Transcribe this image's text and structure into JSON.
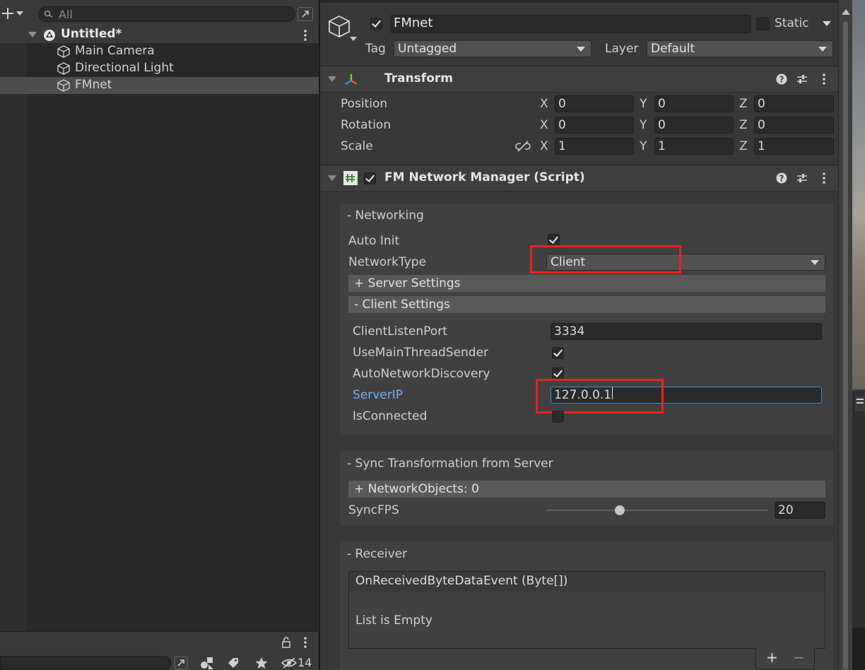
{
  "hierarchy": {
    "search_placeholder": "All",
    "scene_name": "Untitled*",
    "items": [
      {
        "label": "Main Camera"
      },
      {
        "label": "Directional Light"
      },
      {
        "label": "FMnet"
      }
    ],
    "hidden_count": "14"
  },
  "inspector": {
    "object_name": "FMnet",
    "static_label": "Static",
    "tag_label": "Tag",
    "tag_value": "Untagged",
    "layer_label": "Layer",
    "layer_value": "Default",
    "transform": {
      "title": "Transform",
      "rows": [
        {
          "label": "Position",
          "x": "0",
          "y": "0",
          "z": "0"
        },
        {
          "label": "Rotation",
          "x": "0",
          "y": "0",
          "z": "0"
        },
        {
          "label": "Scale",
          "x": "1",
          "y": "1",
          "z": "1"
        }
      ],
      "axis_x": "X",
      "axis_y": "Y",
      "axis_z": "Z"
    },
    "script": {
      "title": "FM Network Manager (Script)",
      "networking": {
        "header": "- Networking",
        "auto_init_label": "Auto Init",
        "network_type_label": "NetworkType",
        "network_type_value": "Client",
        "server_settings": "+ Server Settings",
        "client_settings": "- Client Settings",
        "client_listen_port_label": "ClientListenPort",
        "client_listen_port_value": "3334",
        "use_main_thread_sender_label": "UseMainThreadSender",
        "auto_network_discovery_label": "AutoNetworkDiscovery",
        "server_ip_label": "ServerIP",
        "server_ip_value": "127.0.0.1",
        "is_connected_label": "IsConnected"
      },
      "sync": {
        "header": "- Sync Transformation from Server",
        "network_objects": "+ NetworkObjects: 0",
        "sync_fps_label": "SyncFPS",
        "sync_fps_value": "20",
        "sync_fps_slider_fraction": 0.33
      },
      "receiver": {
        "header": "- Receiver",
        "event_title": "OnReceivedByteDataEvent (Byte[])",
        "empty_text": "List is Empty",
        "add_label": "+",
        "remove_label": "−"
      }
    }
  },
  "colors": {
    "highlight_red": "#e8231d",
    "focus_blue": "#3e8ed6",
    "label_blue": "#7aaef5"
  }
}
